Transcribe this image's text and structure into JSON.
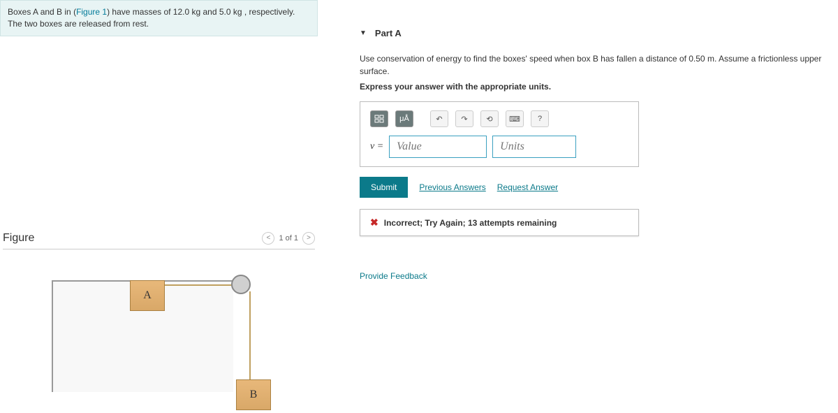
{
  "problem": {
    "text_before": "Boxes A and B in (",
    "figure_link": "Figure 1",
    "text_after": ") have masses of 12.0  kg and 5.0  kg , respectively. The two boxes are released from rest."
  },
  "figure": {
    "title": "Figure",
    "nav_label": "1 of 1",
    "box_a": "A",
    "box_b": "B"
  },
  "part": {
    "header": "Part A",
    "instruction": "Use conservation of energy to find the boxes' speed when box B has fallen a distance of 0.50 m. Assume a frictionless upper surface.",
    "instruction_bold": "Express your answer with the appropriate units.",
    "var_label": "v =",
    "value_placeholder": "Value",
    "units_placeholder": "Units",
    "toolbar": {
      "units_btn": "μÅ",
      "help": "?"
    },
    "submit_label": "Submit",
    "prev_answers": "Previous Answers",
    "request_answer": "Request Answer",
    "feedback": "Incorrect; Try Again; 13 attempts remaining",
    "provide_feedback": "Provide Feedback"
  }
}
